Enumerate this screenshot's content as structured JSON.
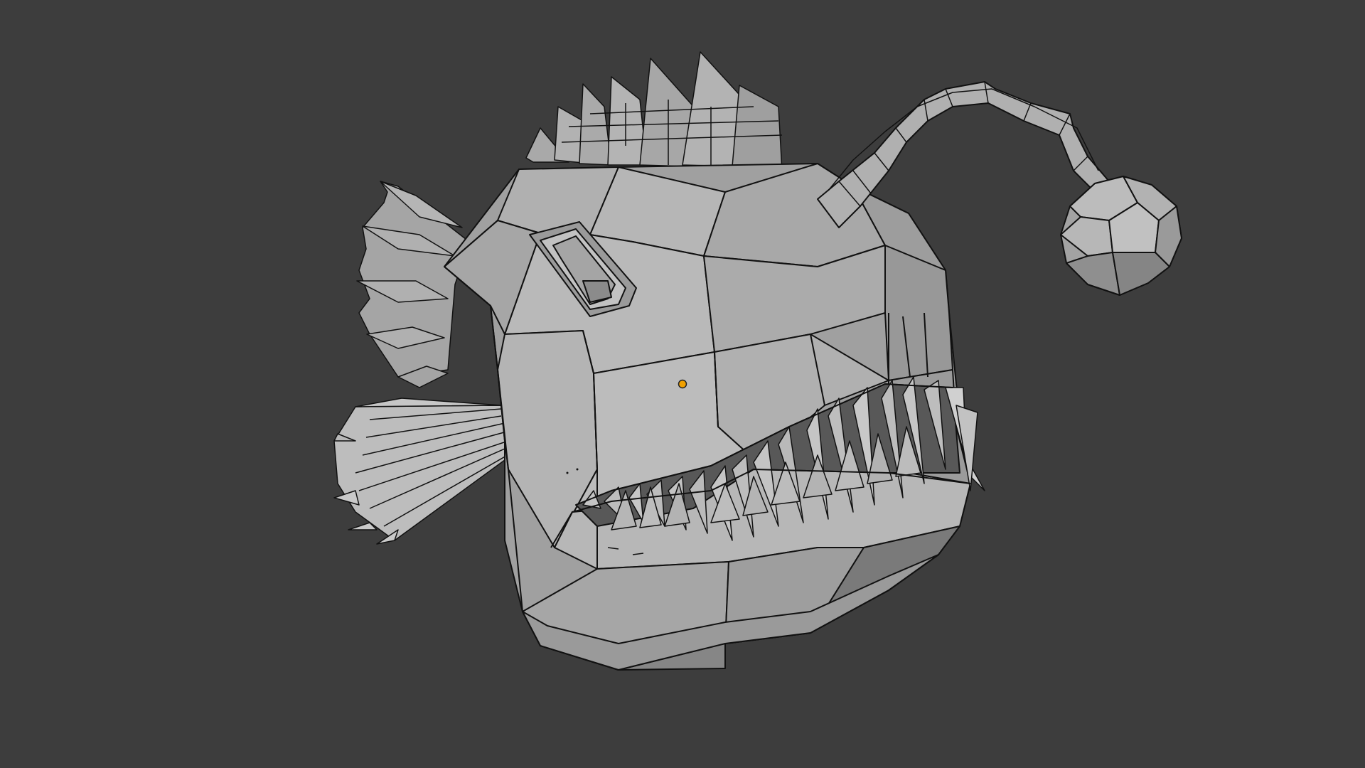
{
  "viewport": {
    "background_color": "#3d3d3d",
    "object": {
      "description_icon": "anglerfish-mesh",
      "face_color_light": "#b4b4b4",
      "face_color_mid": "#9a9a9a",
      "face_color_dark": "#6f6f6f",
      "wire_color": "#111111",
      "origin_color": "#f0a000",
      "shading": "solid",
      "display": "wireframe-overlay"
    }
  }
}
